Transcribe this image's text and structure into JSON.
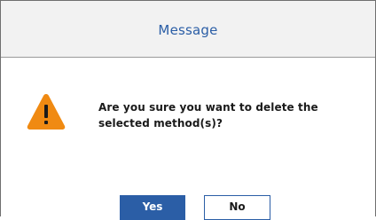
{
  "dialog": {
    "title": "Message",
    "message": "Are you sure you want to delete the selected method(s)?",
    "icon": "warning-icon",
    "buttons": {
      "yes_label": "Yes",
      "no_label": "No"
    },
    "colors": {
      "accent": "#2b5ea6",
      "warning": "#f08a12",
      "titlebar_bg": "#f2f2f2"
    }
  }
}
